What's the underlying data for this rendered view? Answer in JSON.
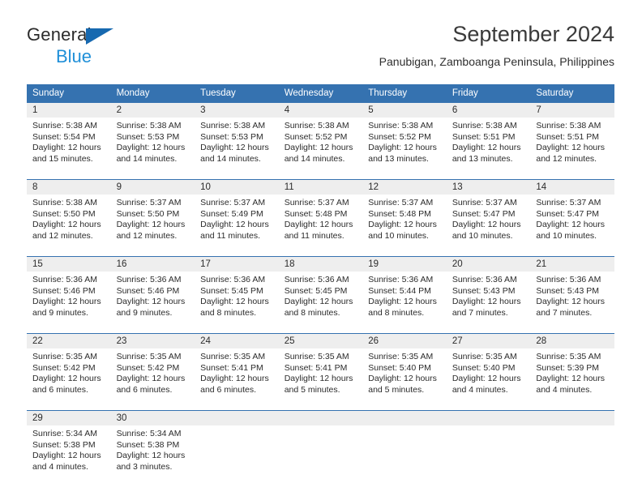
{
  "logo": {
    "line1": "General",
    "line2": "Blue",
    "triangle_color": "#1769b0",
    "line2_color": "#1f8fd8"
  },
  "header": {
    "title": "September 2024",
    "subtitle": "Panubigan, Zamboanga Peninsula, Philippines"
  },
  "theme": {
    "header_blue": "#3572b0",
    "daynum_band": "#eeeeee",
    "text": "#2b2b2b"
  },
  "calendar": {
    "weekday_headers": [
      "Sunday",
      "Monday",
      "Tuesday",
      "Wednesday",
      "Thursday",
      "Friday",
      "Saturday"
    ],
    "weeks": [
      [
        {
          "day": "1",
          "sunrise": "Sunrise: 5:38 AM",
          "sunset": "Sunset: 5:54 PM",
          "daylight1": "Daylight: 12 hours",
          "daylight2": "and 15 minutes."
        },
        {
          "day": "2",
          "sunrise": "Sunrise: 5:38 AM",
          "sunset": "Sunset: 5:53 PM",
          "daylight1": "Daylight: 12 hours",
          "daylight2": "and 14 minutes."
        },
        {
          "day": "3",
          "sunrise": "Sunrise: 5:38 AM",
          "sunset": "Sunset: 5:53 PM",
          "daylight1": "Daylight: 12 hours",
          "daylight2": "and 14 minutes."
        },
        {
          "day": "4",
          "sunrise": "Sunrise: 5:38 AM",
          "sunset": "Sunset: 5:52 PM",
          "daylight1": "Daylight: 12 hours",
          "daylight2": "and 14 minutes."
        },
        {
          "day": "5",
          "sunrise": "Sunrise: 5:38 AM",
          "sunset": "Sunset: 5:52 PM",
          "daylight1": "Daylight: 12 hours",
          "daylight2": "and 13 minutes."
        },
        {
          "day": "6",
          "sunrise": "Sunrise: 5:38 AM",
          "sunset": "Sunset: 5:51 PM",
          "daylight1": "Daylight: 12 hours",
          "daylight2": "and 13 minutes."
        },
        {
          "day": "7",
          "sunrise": "Sunrise: 5:38 AM",
          "sunset": "Sunset: 5:51 PM",
          "daylight1": "Daylight: 12 hours",
          "daylight2": "and 12 minutes."
        }
      ],
      [
        {
          "day": "8",
          "sunrise": "Sunrise: 5:38 AM",
          "sunset": "Sunset: 5:50 PM",
          "daylight1": "Daylight: 12 hours",
          "daylight2": "and 12 minutes."
        },
        {
          "day": "9",
          "sunrise": "Sunrise: 5:37 AM",
          "sunset": "Sunset: 5:50 PM",
          "daylight1": "Daylight: 12 hours",
          "daylight2": "and 12 minutes."
        },
        {
          "day": "10",
          "sunrise": "Sunrise: 5:37 AM",
          "sunset": "Sunset: 5:49 PM",
          "daylight1": "Daylight: 12 hours",
          "daylight2": "and 11 minutes."
        },
        {
          "day": "11",
          "sunrise": "Sunrise: 5:37 AM",
          "sunset": "Sunset: 5:48 PM",
          "daylight1": "Daylight: 12 hours",
          "daylight2": "and 11 minutes."
        },
        {
          "day": "12",
          "sunrise": "Sunrise: 5:37 AM",
          "sunset": "Sunset: 5:48 PM",
          "daylight1": "Daylight: 12 hours",
          "daylight2": "and 10 minutes."
        },
        {
          "day": "13",
          "sunrise": "Sunrise: 5:37 AM",
          "sunset": "Sunset: 5:47 PM",
          "daylight1": "Daylight: 12 hours",
          "daylight2": "and 10 minutes."
        },
        {
          "day": "14",
          "sunrise": "Sunrise: 5:37 AM",
          "sunset": "Sunset: 5:47 PM",
          "daylight1": "Daylight: 12 hours",
          "daylight2": "and 10 minutes."
        }
      ],
      [
        {
          "day": "15",
          "sunrise": "Sunrise: 5:36 AM",
          "sunset": "Sunset: 5:46 PM",
          "daylight1": "Daylight: 12 hours",
          "daylight2": "and 9 minutes."
        },
        {
          "day": "16",
          "sunrise": "Sunrise: 5:36 AM",
          "sunset": "Sunset: 5:46 PM",
          "daylight1": "Daylight: 12 hours",
          "daylight2": "and 9 minutes."
        },
        {
          "day": "17",
          "sunrise": "Sunrise: 5:36 AM",
          "sunset": "Sunset: 5:45 PM",
          "daylight1": "Daylight: 12 hours",
          "daylight2": "and 8 minutes."
        },
        {
          "day": "18",
          "sunrise": "Sunrise: 5:36 AM",
          "sunset": "Sunset: 5:45 PM",
          "daylight1": "Daylight: 12 hours",
          "daylight2": "and 8 minutes."
        },
        {
          "day": "19",
          "sunrise": "Sunrise: 5:36 AM",
          "sunset": "Sunset: 5:44 PM",
          "daylight1": "Daylight: 12 hours",
          "daylight2": "and 8 minutes."
        },
        {
          "day": "20",
          "sunrise": "Sunrise: 5:36 AM",
          "sunset": "Sunset: 5:43 PM",
          "daylight1": "Daylight: 12 hours",
          "daylight2": "and 7 minutes."
        },
        {
          "day": "21",
          "sunrise": "Sunrise: 5:36 AM",
          "sunset": "Sunset: 5:43 PM",
          "daylight1": "Daylight: 12 hours",
          "daylight2": "and 7 minutes."
        }
      ],
      [
        {
          "day": "22",
          "sunrise": "Sunrise: 5:35 AM",
          "sunset": "Sunset: 5:42 PM",
          "daylight1": "Daylight: 12 hours",
          "daylight2": "and 6 minutes."
        },
        {
          "day": "23",
          "sunrise": "Sunrise: 5:35 AM",
          "sunset": "Sunset: 5:42 PM",
          "daylight1": "Daylight: 12 hours",
          "daylight2": "and 6 minutes."
        },
        {
          "day": "24",
          "sunrise": "Sunrise: 5:35 AM",
          "sunset": "Sunset: 5:41 PM",
          "daylight1": "Daylight: 12 hours",
          "daylight2": "and 6 minutes."
        },
        {
          "day": "25",
          "sunrise": "Sunrise: 5:35 AM",
          "sunset": "Sunset: 5:41 PM",
          "daylight1": "Daylight: 12 hours",
          "daylight2": "and 5 minutes."
        },
        {
          "day": "26",
          "sunrise": "Sunrise: 5:35 AM",
          "sunset": "Sunset: 5:40 PM",
          "daylight1": "Daylight: 12 hours",
          "daylight2": "and 5 minutes."
        },
        {
          "day": "27",
          "sunrise": "Sunrise: 5:35 AM",
          "sunset": "Sunset: 5:40 PM",
          "daylight1": "Daylight: 12 hours",
          "daylight2": "and 4 minutes."
        },
        {
          "day": "28",
          "sunrise": "Sunrise: 5:35 AM",
          "sunset": "Sunset: 5:39 PM",
          "daylight1": "Daylight: 12 hours",
          "daylight2": "and 4 minutes."
        }
      ],
      [
        {
          "day": "29",
          "sunrise": "Sunrise: 5:34 AM",
          "sunset": "Sunset: 5:38 PM",
          "daylight1": "Daylight: 12 hours",
          "daylight2": "and 4 minutes."
        },
        {
          "day": "30",
          "sunrise": "Sunrise: 5:34 AM",
          "sunset": "Sunset: 5:38 PM",
          "daylight1": "Daylight: 12 hours",
          "daylight2": "and 3 minutes."
        },
        {
          "day": "",
          "sunrise": "",
          "sunset": "",
          "daylight1": "",
          "daylight2": ""
        },
        {
          "day": "",
          "sunrise": "",
          "sunset": "",
          "daylight1": "",
          "daylight2": ""
        },
        {
          "day": "",
          "sunrise": "",
          "sunset": "",
          "daylight1": "",
          "daylight2": ""
        },
        {
          "day": "",
          "sunrise": "",
          "sunset": "",
          "daylight1": "",
          "daylight2": ""
        },
        {
          "day": "",
          "sunrise": "",
          "sunset": "",
          "daylight1": "",
          "daylight2": ""
        }
      ]
    ]
  }
}
